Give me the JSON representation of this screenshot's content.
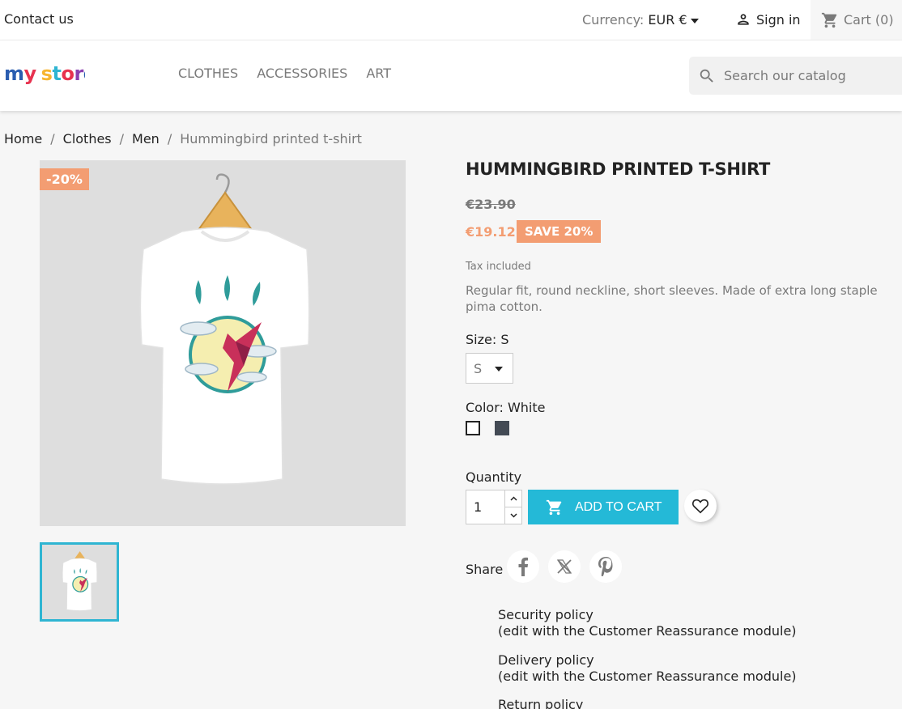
{
  "topbar": {
    "contact": "Contact us",
    "currency_label": "Currency:",
    "currency_value": "EUR €",
    "signin": "Sign in",
    "cart": "Cart (0)"
  },
  "header": {
    "logo_text": "my store",
    "nav": [
      "CLOTHES",
      "ACCESSORIES",
      "ART"
    ],
    "search_placeholder": "Search our catalog"
  },
  "breadcrumb": {
    "items": [
      "Home",
      "Clothes",
      "Men"
    ],
    "current": "Hummingbird printed t-shirt",
    "separator": "/"
  },
  "product": {
    "discount_flag": "-20%",
    "title": "HUMMINGBIRD PRINTED T-SHIRT",
    "regular_price": "€23.90",
    "price": "€19.12",
    "save_badge": "SAVE 20%",
    "tax": "Tax included",
    "description": "Regular fit, round neckline, short sleeves. Made of extra long staple pima cotton.",
    "size_label": "Size: S",
    "size_value": "S",
    "color_label": "Color: White",
    "colors": [
      "#ffffff",
      "#434a54"
    ],
    "quantity_label": "Quantity",
    "quantity_value": "1",
    "add_to_cart": "ADD TO CART",
    "share_label": "Share"
  },
  "reassurance": [
    {
      "title": "Security policy",
      "sub": "(edit with the Customer Reassurance module)"
    },
    {
      "title": "Delivery policy",
      "sub": "(edit with the Customer Reassurance module)"
    },
    {
      "title": "Return policy"
    }
  ],
  "colors": {
    "accent": "#24b9d7",
    "discount": "#f39d72"
  }
}
